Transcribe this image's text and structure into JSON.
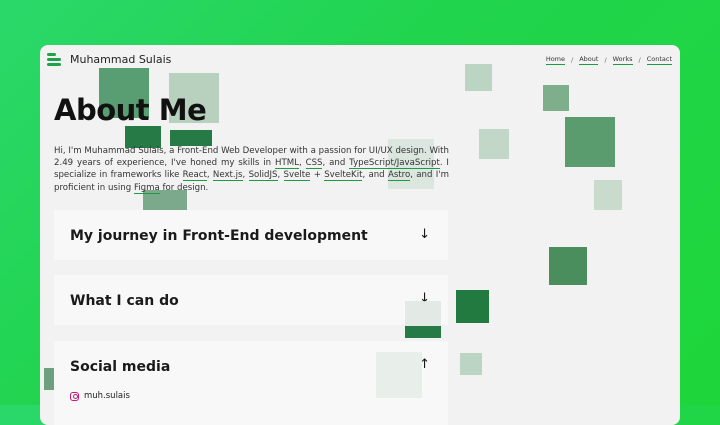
{
  "header": {
    "brand": "Muhammad Sulais",
    "nav": [
      {
        "label": "Home"
      },
      {
        "label": "About"
      },
      {
        "label": "Works"
      },
      {
        "label": "Contact"
      }
    ],
    "separator": "/",
    "active_nav": "About"
  },
  "main": {
    "title": "About Me",
    "intro": {
      "t1": "Hi, I'm Muhammad Sulais, a Front-End Web Developer with a passion for UI/UX design. With 2.49 years of experience, I've honed my skills in ",
      "html": "HTML",
      "sep1": ", ",
      "css": "CSS",
      "sep2": ", and ",
      "ts": "TypeScript/JavaScript",
      "t2": ". I specialize in frameworks like ",
      "react": "React",
      "sep3": ", ",
      "next": "Next.js",
      "sep4": ", ",
      "solid": "SolidJS",
      "sep5": ", ",
      "svelte": "Svelte",
      "sep6": " + ",
      "sveltekit": "SvelteKit",
      "sep7": ", and ",
      "astro": "Astro",
      "t3": ", and I'm proficient in using ",
      "figma": "Figma",
      "t4": " for design."
    },
    "sections": [
      {
        "title": "My journey in Front-End development",
        "arrow": "↓"
      },
      {
        "title": "What I can do",
        "arrow": "↓"
      },
      {
        "title": "Social media",
        "arrow": "↑"
      }
    ],
    "social": {
      "instagram": "muh.sulais"
    }
  },
  "colors": {
    "accent": "#1d9a45",
    "background_gradient_start": "#2ad86a",
    "background_gradient_end": "#1ed63a",
    "window_bg": "#f2f2f2"
  }
}
